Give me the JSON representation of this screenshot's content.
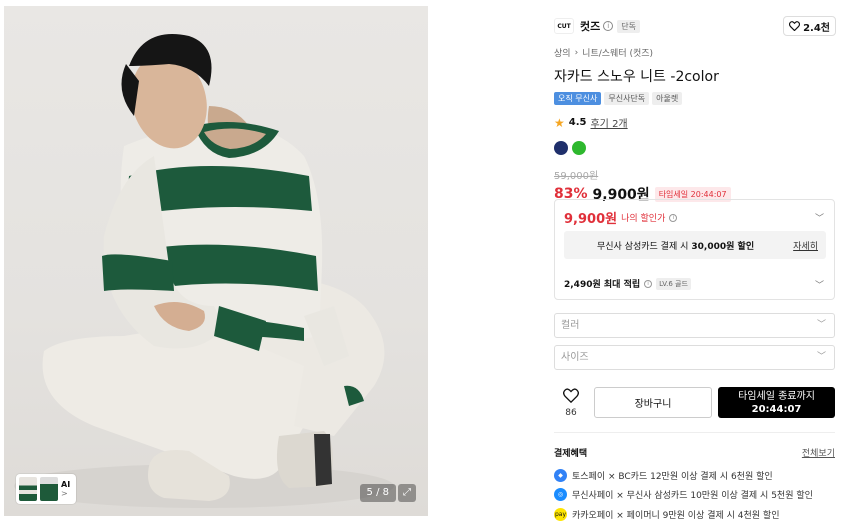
{
  "gallery": {
    "counter": "5 / 8",
    "ai_label": "AI",
    "ai_arrow": ">",
    "expand_icon": "expand-icon"
  },
  "brand": {
    "logo": "CUT",
    "name": "컷즈",
    "tag": "단독",
    "likes": "2.4천"
  },
  "breadcrumb": [
    "상의",
    "니트/스웨터 (컷즈)"
  ],
  "product": {
    "title": "자카드 스노우 니트 -2color",
    "badges": [
      "오직 무신사",
      "무신사단독",
      "아울렛"
    ],
    "rating": "4.5",
    "reviews": "후기 2개",
    "colors": [
      "#1f2f6b",
      "#2eb82e"
    ],
    "original_price": "59,000원",
    "discount": "83%",
    "price": "9,900원",
    "timesale": "타임세일 20:44:07"
  },
  "benefit": {
    "my_price": "9,900원",
    "my_price_label": "나의 할인가",
    "card_text": "무신사 삼성카드 결제 시",
    "card_amount": "30,000원 할인",
    "card_detail": "자세히",
    "points": "2,490원 최대 적립",
    "level": "LV.6 골드"
  },
  "options": {
    "color_placeholder": "컬러",
    "size_placeholder": "사이즈"
  },
  "actions": {
    "like_count": "86",
    "cart": "장바구니",
    "buy_line1": "타임세일 종료까지",
    "buy_line2": "20:44:07"
  },
  "payment": {
    "header": "결제혜택",
    "more": "전체보기",
    "items": [
      {
        "text": "토스페이 × BC카드 12만원 이상 결제 시 6천원 할인",
        "icon_color": "#3182f6"
      },
      {
        "text": "무신사페이 × 무신사 삼성카드 10만원 이상 결제 시 5천원 할인",
        "icon_color": "#1a8cff"
      },
      {
        "text": "카카오페이 × 페이머니 9만원 이상 결제 시 4천원 할인",
        "icon_color": "#fee500"
      }
    ]
  }
}
